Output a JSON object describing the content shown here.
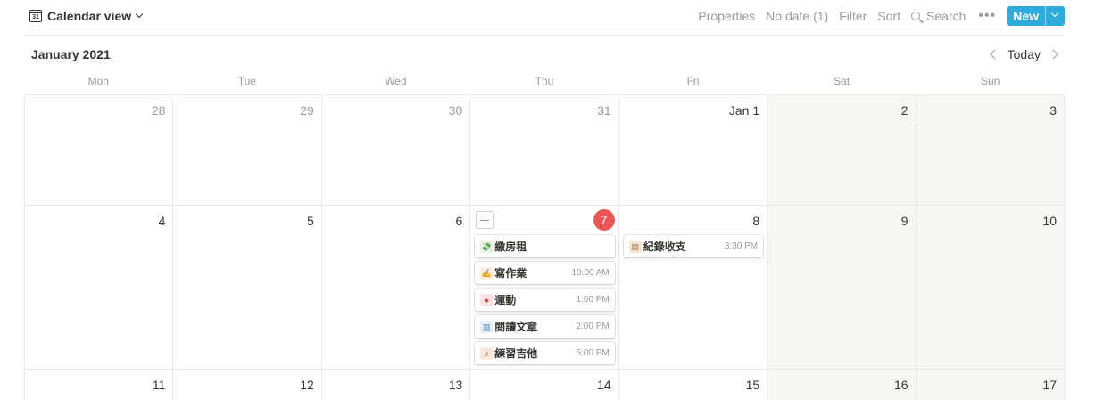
{
  "toolbar": {
    "view_label": "Calendar view",
    "calendar_icon_text": "31",
    "properties": "Properties",
    "no_date": "No date (1)",
    "filter": "Filter",
    "sort": "Sort",
    "search": "Search",
    "more": "•••",
    "new_label": "New",
    "accent_color": "#2eaadc"
  },
  "calendar": {
    "month_title": "January 2021",
    "today_label": "Today",
    "weekdays": [
      "Mon",
      "Tue",
      "Wed",
      "Thu",
      "Fri",
      "Sat",
      "Sun"
    ],
    "today_color": "#eb5757",
    "weeks": [
      [
        "28",
        "29",
        "30",
        "31",
        "Jan 1",
        "2",
        "3"
      ],
      [
        "4",
        "5",
        "6",
        "7",
        "8",
        "9",
        "10"
      ],
      [
        "11",
        "12",
        "13",
        "14",
        "15",
        "16",
        "17"
      ]
    ],
    "events": {
      "jan7": [
        {
          "icon": "money-wings-icon",
          "name": "繳房租",
          "time": ""
        },
        {
          "icon": "writing-hand-icon",
          "name": "寫作業",
          "time": "10:00 AM"
        },
        {
          "icon": "ping-pong-icon",
          "name": "運動",
          "time": "1:00 PM"
        },
        {
          "icon": "book-icon",
          "name": "閱讀文章",
          "time": "2:00 PM"
        },
        {
          "icon": "guitar-icon",
          "name": "練習吉他",
          "time": "5:00 PM"
        }
      ],
      "jan8": [
        {
          "icon": "ledger-icon",
          "name": "紀錄收支",
          "time": "3:30 PM"
        }
      ]
    }
  }
}
